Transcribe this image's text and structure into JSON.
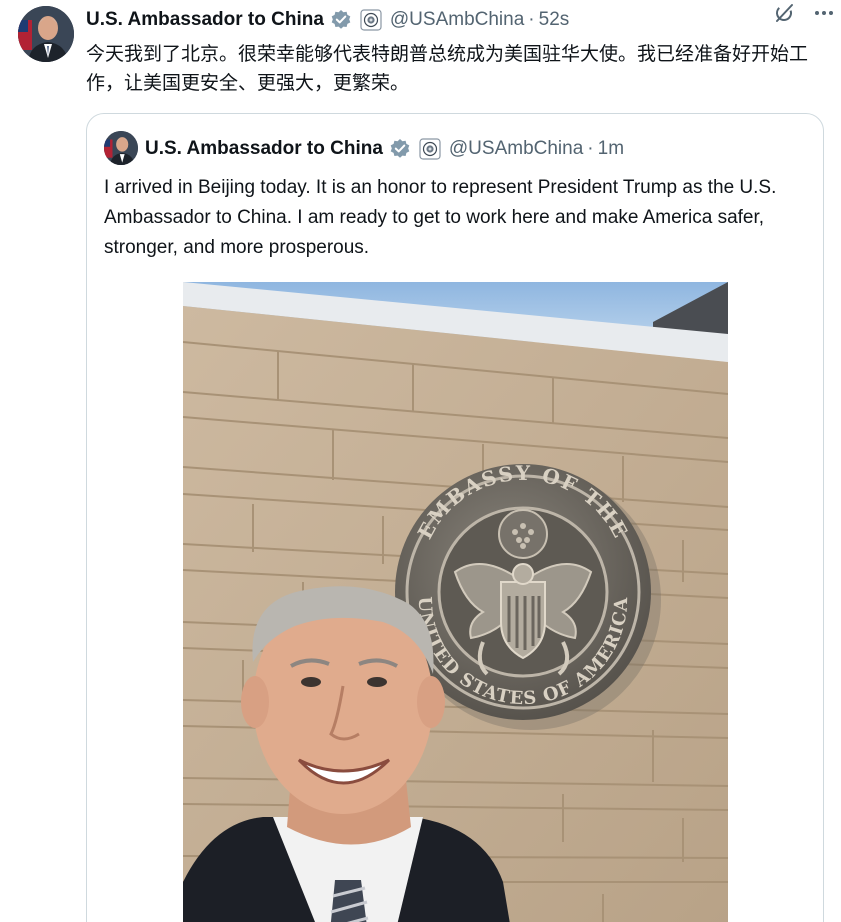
{
  "tweet": {
    "author_name": "U.S. Ambassador to China",
    "handle": "@USAmbChina",
    "separator": "·",
    "time": "52s",
    "text": "今天我到了北京。很荣幸能够代表特朗普总统成为美国驻华大使。我已经准备好开始工作，让美国更安全、更强大，更繁荣。"
  },
  "quoted": {
    "author_name": "U.S. Ambassador to China",
    "handle": "@USAmbChina",
    "separator": "·",
    "time": "1m",
    "text": "I arrived in Beijing today. It is an honor to represent President Trump as the U.S. Ambassador to China. I am ready to get to work here and make America safer, stronger, and more prosperous."
  },
  "icons": {
    "verified": "verified-badge-icon",
    "affiliate": "government-seal-icon",
    "grok": "grok-icon",
    "more": "more-options-icon"
  },
  "photo": {
    "seal_text_top": "EMBASSY OF THE",
    "seal_text_bottom": "UNITED STATES OF AMERICA"
  },
  "colors": {
    "text": "#0f1419",
    "secondary": "#536471",
    "verified": "#829aab",
    "border": "#cfd9de"
  }
}
